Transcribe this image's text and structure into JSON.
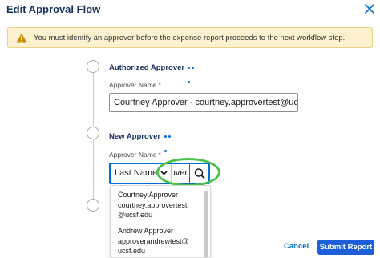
{
  "dialog": {
    "title": "Edit Approval Flow"
  },
  "warning": {
    "text": "You must identify an approver before the expense report proceeds to the next workflow step."
  },
  "authorized": {
    "title": "Authorized Approver",
    "field_label": "Approver Name",
    "required_mark": "*",
    "value": "Courtney Approver - courtney.approvertest@ucsf.e"
  },
  "new_approver": {
    "title": "New Approver",
    "field_label": "Approver Name",
    "required_mark": "*",
    "search_type": "Last Name",
    "query": "over"
  },
  "dropdown": {
    "items": [
      {
        "line1": "Courtney Approver",
        "line2": "courtney.approvertest",
        "line3": "@ucsf.edu"
      },
      {
        "line1": "Andrew Approver",
        "line2": "approverandrewtest@",
        "line3": "ucsf.edu"
      }
    ]
  },
  "footer": {
    "cancel_label": "Cancel",
    "submit_label": "Submit Report"
  },
  "icons": {
    "close": "close-icon",
    "warning": "warning-icon",
    "more": "more-icon",
    "search": "search-icon",
    "chevron": "chevron-down-icon"
  },
  "colors": {
    "accent": "#0070d2",
    "submit": "#1c5fd8",
    "warning_bg": "#fcf1cf",
    "highlight": "#4cc24c"
  }
}
